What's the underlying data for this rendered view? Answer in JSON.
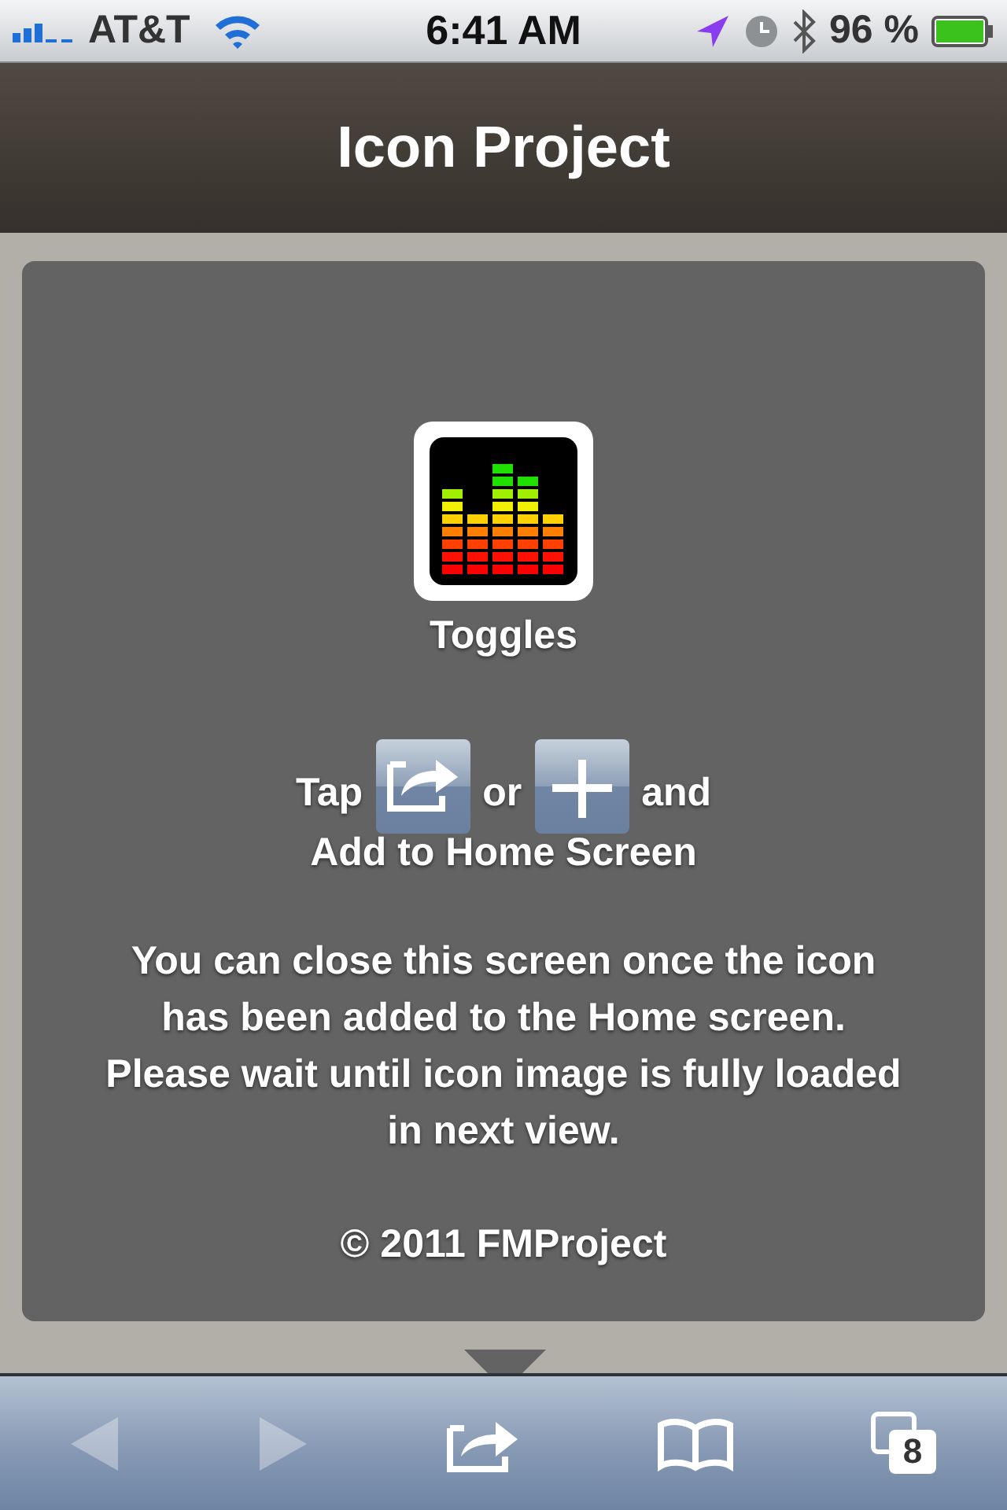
{
  "status_bar": {
    "carrier": "AT&T",
    "time": "6:41 AM",
    "battery": "96 %"
  },
  "header": {
    "title": "Icon Project"
  },
  "card": {
    "app_name": "Toggles",
    "instruction": {
      "before": "Tap",
      "middle": "or",
      "after": "and",
      "line2": "Add to Home Screen"
    },
    "note": "You can close this screen once the icon has been added to the Home screen. Please wait until icon image is fully loaded in next view.",
    "copyright": "© 2011 FMProject"
  },
  "toolbar": {
    "back": {
      "disabled": true
    },
    "forward": {
      "disabled": true
    },
    "tab_count": "8"
  }
}
